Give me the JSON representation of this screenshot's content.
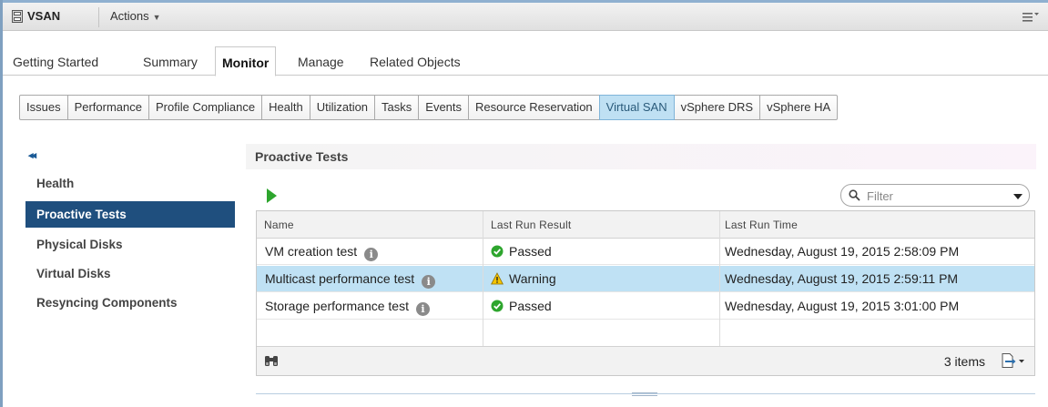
{
  "header": {
    "object_icon": "vsan-cluster-icon",
    "title": "VSAN",
    "actions_label": "Actions",
    "menu_icon": "list-menu-icon"
  },
  "top_tabs": [
    {
      "label": "Getting Started",
      "active": false
    },
    {
      "label": "Summary",
      "active": false
    },
    {
      "label": "Monitor",
      "active": true
    },
    {
      "label": "Manage",
      "active": false
    },
    {
      "label": "Related Objects",
      "active": false
    }
  ],
  "sub_tabs": [
    {
      "label": "Issues",
      "active": false
    },
    {
      "label": "Performance",
      "active": false
    },
    {
      "label": "Profile Compliance",
      "active": false
    },
    {
      "label": "Health",
      "active": false
    },
    {
      "label": "Utilization",
      "active": false
    },
    {
      "label": "Tasks",
      "active": false
    },
    {
      "label": "Events",
      "active": false
    },
    {
      "label": "Resource Reservation",
      "active": false
    },
    {
      "label": "Virtual SAN",
      "active": true
    },
    {
      "label": "vSphere DRS",
      "active": false
    },
    {
      "label": "vSphere HA",
      "active": false
    }
  ],
  "sidenav": {
    "collapse_glyph": "◂◂",
    "items": [
      {
        "label": "Health",
        "active": false
      },
      {
        "label": "Proactive Tests",
        "active": true
      },
      {
        "label": "Physical Disks",
        "active": false
      },
      {
        "label": "Virtual Disks",
        "active": false
      },
      {
        "label": "Resyncing Components",
        "active": false
      }
    ]
  },
  "panel": {
    "title": "Proactive Tests",
    "run_icon": "play-icon",
    "filter_placeholder": "Filter"
  },
  "grid": {
    "columns": [
      "Name",
      "Last Run Result",
      "Last Run Time"
    ],
    "rows": [
      {
        "name": "VM creation test",
        "result": "Passed",
        "result_status": "passed",
        "time": "Wednesday, August 19, 2015 2:58:09 PM",
        "selected": false
      },
      {
        "name": "Multicast performance test",
        "result": "Warning",
        "result_status": "warning",
        "time": "Wednesday, August 19, 2015 2:59:11 PM",
        "selected": true
      },
      {
        "name": "Storage performance test",
        "result": "Passed",
        "result_status": "passed",
        "time": "Wednesday, August 19, 2015 3:01:00 PM",
        "selected": false
      }
    ],
    "footer": {
      "count_label": "3 items",
      "binoculars_icon": "binoculars-icon",
      "export_icon": "export-icon"
    }
  },
  "colors": {
    "accent": "#1f4f7e",
    "selection": "#bfe1f4",
    "passed": "#2da52d",
    "warning": "#f5c400"
  }
}
